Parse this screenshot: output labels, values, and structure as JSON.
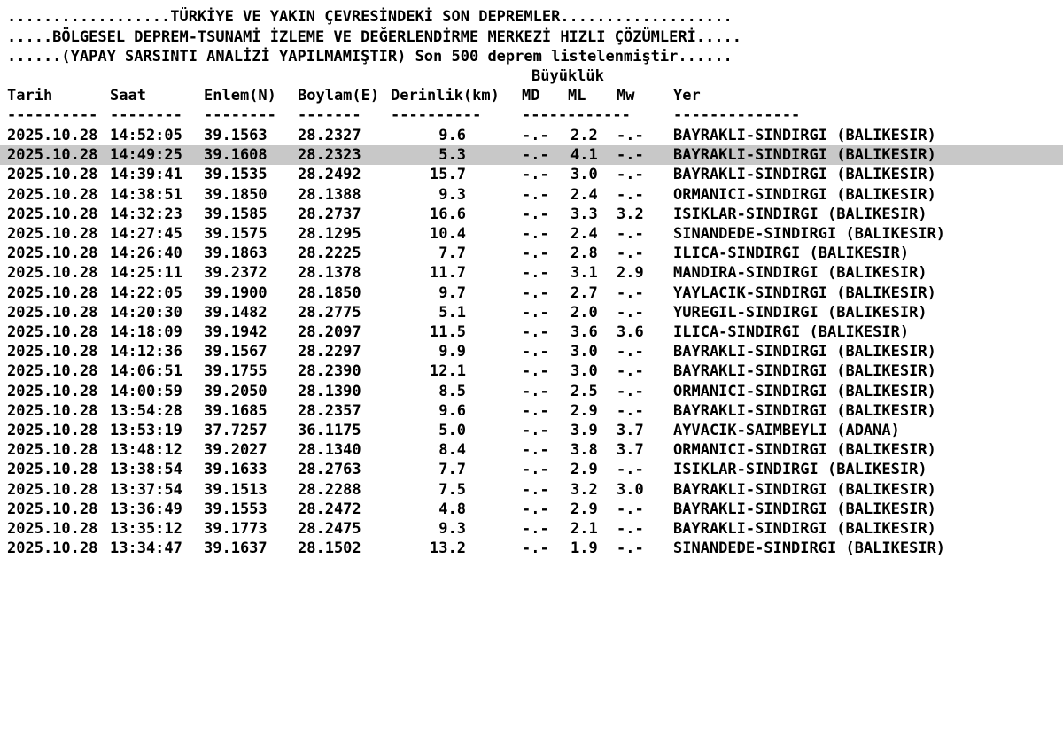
{
  "header": {
    "line1": "..................TÜRKİYE VE YAKIN ÇEVRESİNDEKİ SON DEPREMLER...................",
    "line2": ".....BÖLGESEL DEPREM-TSUNAMİ İZLEME VE DEĞERLENDİRME MERKEZİ HIZLI ÇÖZÜMLERİ.....",
    "line3": "......(YAPAY SARSINTI ANALİZİ YAPILMAMIŞTIR) Son 500 deprem listelenmiştir......"
  },
  "columns": {
    "group_label": "Büyüklük",
    "tarih": "Tarih",
    "saat": "Saat",
    "enlem": "Enlem(N)",
    "boylam": "Boylam(E)",
    "derinlik": "Derinlik(km)",
    "md": "MD",
    "ml": "ML",
    "mw": "Mw",
    "yer": "Yer"
  },
  "separators": {
    "tarih": "----------",
    "saat": "--------",
    "enlem": "--------",
    "boylam": "-------",
    "derinlik": "----------",
    "mag": "------------",
    "yer": "--------------"
  },
  "rows": [
    {
      "tarih": "2025.10.28",
      "saat": "14:52:05",
      "enlem": "39.1563",
      "boylam": "28.2327",
      "derinlik": "9.6",
      "md": "-.-",
      "ml": "2.2",
      "mw": "-.-",
      "yer": "BAYRAKLI-SINDIRGI (BALIKESIR)"
    },
    {
      "tarih": "2025.10.28",
      "saat": "14:49:25",
      "enlem": "39.1608",
      "boylam": "28.2323",
      "derinlik": "5.3",
      "md": "-.-",
      "ml": "4.1",
      "mw": "-.-",
      "yer": "BAYRAKLI-SINDIRGI (BALIKESIR)"
    },
    {
      "tarih": "2025.10.28",
      "saat": "14:39:41",
      "enlem": "39.1535",
      "boylam": "28.2492",
      "derinlik": "15.7",
      "md": "-.-",
      "ml": "3.0",
      "mw": "-.-",
      "yer": "BAYRAKLI-SINDIRGI (BALIKESIR)"
    },
    {
      "tarih": "2025.10.28",
      "saat": "14:38:51",
      "enlem": "39.1850",
      "boylam": "28.1388",
      "derinlik": "9.3",
      "md": "-.-",
      "ml": "2.4",
      "mw": "-.-",
      "yer": "ORMANICI-SINDIRGI (BALIKESIR)"
    },
    {
      "tarih": "2025.10.28",
      "saat": "14:32:23",
      "enlem": "39.1585",
      "boylam": "28.2737",
      "derinlik": "16.6",
      "md": "-.-",
      "ml": "3.3",
      "mw": "3.2",
      "yer": "ISIKLAR-SINDIRGI (BALIKESIR)"
    },
    {
      "tarih": "2025.10.28",
      "saat": "14:27:45",
      "enlem": "39.1575",
      "boylam": "28.1295",
      "derinlik": "10.4",
      "md": "-.-",
      "ml": "2.4",
      "mw": "-.-",
      "yer": "SINANDEDE-SINDIRGI (BALIKESIR)"
    },
    {
      "tarih": "2025.10.28",
      "saat": "14:26:40",
      "enlem": "39.1863",
      "boylam": "28.2225",
      "derinlik": "7.7",
      "md": "-.-",
      "ml": "2.8",
      "mw": "-.-",
      "yer": "ILICA-SINDIRGI (BALIKESIR)"
    },
    {
      "tarih": "2025.10.28",
      "saat": "14:25:11",
      "enlem": "39.2372",
      "boylam": "28.1378",
      "derinlik": "11.7",
      "md": "-.-",
      "ml": "3.1",
      "mw": "2.9",
      "yer": "MANDIRA-SINDIRGI (BALIKESIR)"
    },
    {
      "tarih": "2025.10.28",
      "saat": "14:22:05",
      "enlem": "39.1900",
      "boylam": "28.1850",
      "derinlik": "9.7",
      "md": "-.-",
      "ml": "2.7",
      "mw": "-.-",
      "yer": "YAYLACIK-SINDIRGI (BALIKESIR)"
    },
    {
      "tarih": "2025.10.28",
      "saat": "14:20:30",
      "enlem": "39.1482",
      "boylam": "28.2775",
      "derinlik": "5.1",
      "md": "-.-",
      "ml": "2.0",
      "mw": "-.-",
      "yer": "YUREGIL-SINDIRGI (BALIKESIR)"
    },
    {
      "tarih": "2025.10.28",
      "saat": "14:18:09",
      "enlem": "39.1942",
      "boylam": "28.2097",
      "derinlik": "11.5",
      "md": "-.-",
      "ml": "3.6",
      "mw": "3.6",
      "yer": "ILICA-SINDIRGI (BALIKESIR)"
    },
    {
      "tarih": "2025.10.28",
      "saat": "14:12:36",
      "enlem": "39.1567",
      "boylam": "28.2297",
      "derinlik": "9.9",
      "md": "-.-",
      "ml": "3.0",
      "mw": "-.-",
      "yer": "BAYRAKLI-SINDIRGI (BALIKESIR)"
    },
    {
      "tarih": "2025.10.28",
      "saat": "14:06:51",
      "enlem": "39.1755",
      "boylam": "28.2390",
      "derinlik": "12.1",
      "md": "-.-",
      "ml": "3.0",
      "mw": "-.-",
      "yer": "BAYRAKLI-SINDIRGI (BALIKESIR)"
    },
    {
      "tarih": "2025.10.28",
      "saat": "14:00:59",
      "enlem": "39.2050",
      "boylam": "28.1390",
      "derinlik": "8.5",
      "md": "-.-",
      "ml": "2.5",
      "mw": "-.-",
      "yer": "ORMANICI-SINDIRGI (BALIKESIR)"
    },
    {
      "tarih": "2025.10.28",
      "saat": "13:54:28",
      "enlem": "39.1685",
      "boylam": "28.2357",
      "derinlik": "9.6",
      "md": "-.-",
      "ml": "2.9",
      "mw": "-.-",
      "yer": "BAYRAKLI-SINDIRGI (BALIKESIR)"
    },
    {
      "tarih": "2025.10.28",
      "saat": "13:53:19",
      "enlem": "37.7257",
      "boylam": "36.1175",
      "derinlik": "5.0",
      "md": "-.-",
      "ml": "3.9",
      "mw": "3.7",
      "yer": "AYVACIK-SAIMBEYLI (ADANA)"
    },
    {
      "tarih": "2025.10.28",
      "saat": "13:48:12",
      "enlem": "39.2027",
      "boylam": "28.1340",
      "derinlik": "8.4",
      "md": "-.-",
      "ml": "3.8",
      "mw": "3.7",
      "yer": "ORMANICI-SINDIRGI (BALIKESIR)"
    },
    {
      "tarih": "2025.10.28",
      "saat": "13:38:54",
      "enlem": "39.1633",
      "boylam": "28.2763",
      "derinlik": "7.7",
      "md": "-.-",
      "ml": "2.9",
      "mw": "-.-",
      "yer": "ISIKLAR-SINDIRGI (BALIKESIR)"
    },
    {
      "tarih": "2025.10.28",
      "saat": "13:37:54",
      "enlem": "39.1513",
      "boylam": "28.2288",
      "derinlik": "7.5",
      "md": "-.-",
      "ml": "3.2",
      "mw": "3.0",
      "yer": "BAYRAKLI-SINDIRGI (BALIKESIR)"
    },
    {
      "tarih": "2025.10.28",
      "saat": "13:36:49",
      "enlem": "39.1553",
      "boylam": "28.2472",
      "derinlik": "4.8",
      "md": "-.-",
      "ml": "2.9",
      "mw": "-.-",
      "yer": "BAYRAKLI-SINDIRGI (BALIKESIR)"
    },
    {
      "tarih": "2025.10.28",
      "saat": "13:35:12",
      "enlem": "39.1773",
      "boylam": "28.2475",
      "derinlik": "9.3",
      "md": "-.-",
      "ml": "2.1",
      "mw": "-.-",
      "yer": "BAYRAKLI-SINDIRGI (BALIKESIR)"
    },
    {
      "tarih": "2025.10.28",
      "saat": "13:34:47",
      "enlem": "39.1637",
      "boylam": "28.1502",
      "derinlik": "13.2",
      "md": "-.-",
      "ml": "1.9",
      "mw": "-.-",
      "yer": "SINANDEDE-SINDIRGI (BALIKESIR)"
    }
  ],
  "highlight_color": "#c8c8c8"
}
